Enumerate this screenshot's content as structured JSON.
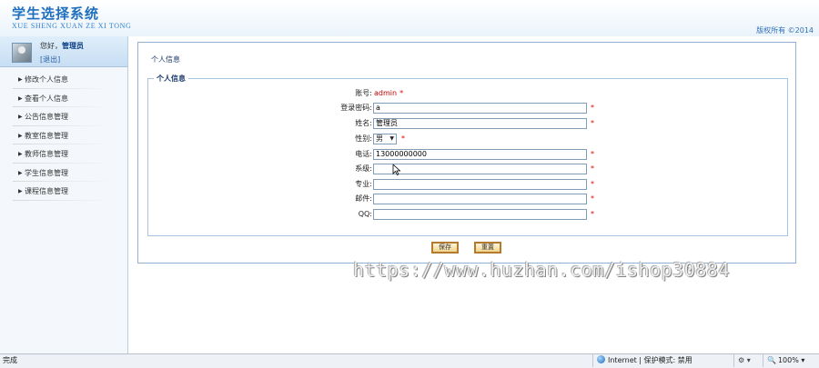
{
  "header": {
    "title_cn": "学生选择系统",
    "title_en": "XUE SHENG XUAN ZE XI TONG",
    "copyright": "版权所有 ©2014"
  },
  "sidebar": {
    "greeting": "您好，",
    "username": "管理员",
    "logout": "[退出]",
    "items": [
      {
        "label": "修改个人信息"
      },
      {
        "label": "查看个人信息"
      },
      {
        "label": "公告信息管理"
      },
      {
        "label": "教室信息管理"
      },
      {
        "label": "教师信息管理"
      },
      {
        "label": "学生信息管理"
      },
      {
        "label": "课程信息管理"
      }
    ]
  },
  "main": {
    "title": "个人信息",
    "legend": "个人信息",
    "fields": {
      "account": {
        "label": "账号:",
        "value": "admin",
        "required": "*"
      },
      "password": {
        "label": "登录密码:",
        "value": "a",
        "required": "*"
      },
      "name": {
        "label": "姓名:",
        "value": "管理员",
        "required": "*"
      },
      "gender": {
        "label": "性别:",
        "value": "男",
        "required": "*"
      },
      "phone": {
        "label": "电话:",
        "value": "13000000000",
        "required": "*"
      },
      "department": {
        "label": "系级:",
        "value": "",
        "required": "*"
      },
      "major": {
        "label": "专业:",
        "value": "",
        "required": "*"
      },
      "email": {
        "label": "邮件:",
        "value": "",
        "required": "*"
      },
      "qq": {
        "label": "QQ:",
        "value": "",
        "required": "*"
      }
    },
    "buttons": {
      "save": "保存",
      "reset": "重置"
    }
  },
  "watermark": "https://www.huzhan.com/ishop30884",
  "statusbar": {
    "status": "完成",
    "zone": "Internet | 保护模式: 禁用",
    "zoom": "100%"
  }
}
